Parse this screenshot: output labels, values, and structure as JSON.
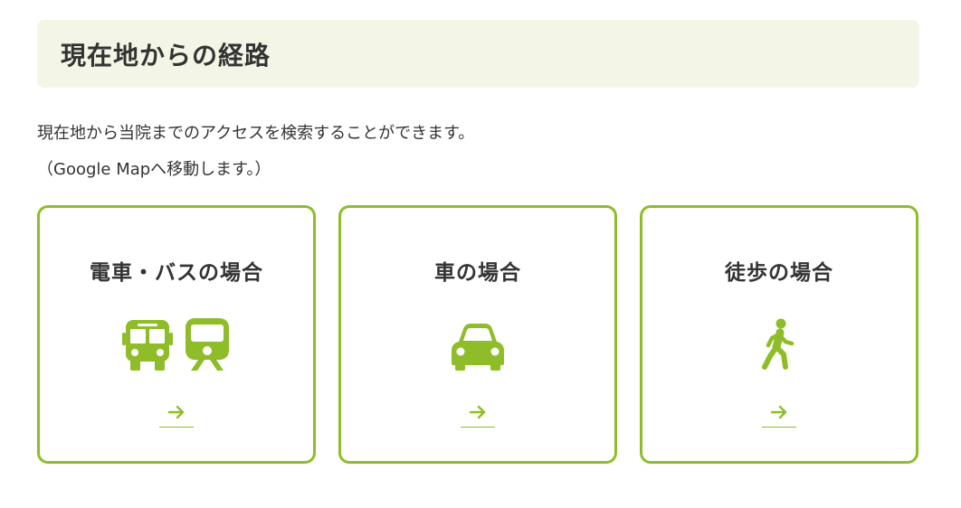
{
  "section": {
    "title": "現在地からの経路"
  },
  "description": {
    "line1": "現在地から当院までのアクセスを検索することができます。",
    "line2": "（Google Mapへ移動します。）"
  },
  "colors": {
    "accent": "#8fbd2a",
    "heading_bg": "#f3f6e6",
    "text": "#333333"
  },
  "cards": [
    {
      "title": "電車・バスの場合",
      "icons": [
        "bus-icon",
        "train-icon"
      ],
      "arrow_icon": "arrow-right-icon"
    },
    {
      "title": "車の場合",
      "icons": [
        "car-icon"
      ],
      "arrow_icon": "arrow-right-icon"
    },
    {
      "title": "徒歩の場合",
      "icons": [
        "walking-person-icon"
      ],
      "arrow_icon": "arrow-right-icon"
    }
  ]
}
